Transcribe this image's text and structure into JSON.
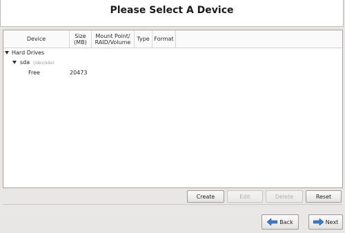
{
  "header": {
    "title": "Please Select A Device"
  },
  "columns": {
    "device": "Device",
    "size_l1": "Size",
    "size_l2": "(MB)",
    "mount_l1": "Mount Point/",
    "mount_l2": "RAID/Volume",
    "type": "Type",
    "format": "Format"
  },
  "tree": {
    "group": "Hard Drives",
    "disk": {
      "name": "sda",
      "path": "(/dev/sda)"
    },
    "free": {
      "label": "Free",
      "size": "20473"
    }
  },
  "actions": {
    "create": "Create",
    "edit": "Edit",
    "delete": "Delete",
    "reset": "Reset"
  },
  "nav": {
    "back": "Back",
    "next": "Next"
  },
  "colors": {
    "accent": "#3465a4",
    "arrow_blue": "#3b7cc7"
  }
}
